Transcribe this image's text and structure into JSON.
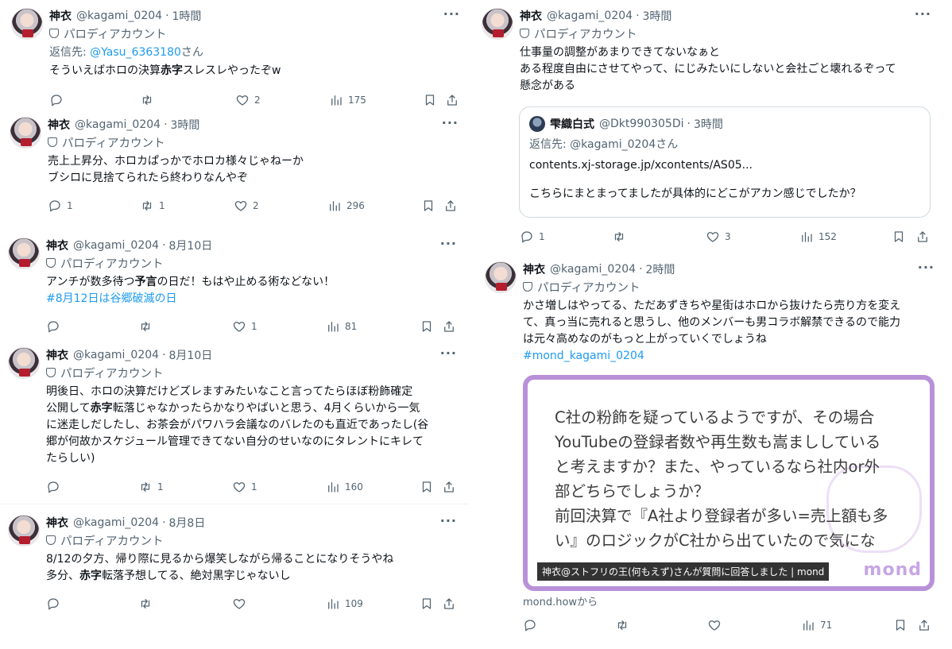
{
  "tweets": [
    {
      "name": "神衣",
      "handle": "@kagami_0204",
      "time": "1時間",
      "parody_label": "パロディアカウント",
      "reply_prefix": "返信先:",
      "reply_handle": "@Yasu_6363180",
      "reply_suffix": "さん",
      "text_a": "そういえばホロの決算",
      "text_bold": "赤字",
      "text_b": "スレスレやったぞw",
      "replies": "",
      "retweets": "",
      "likes": "2",
      "views": "175"
    },
    {
      "name": "神衣",
      "handle": "@kagami_0204",
      "time": "3時間",
      "parody_label": "パロディアカウント",
      "line1": "売上上昇分、ホロカぱっかでホロカ様々じゃねーか",
      "line2": "ブシロに見捨てられたら終わりなんやぞ",
      "replies": "1",
      "retweets": "1",
      "likes": "2",
      "views": "296"
    },
    {
      "name": "神衣",
      "handle": "@kagami_0204",
      "time": "8月10日",
      "parody_label": "パロディアカウント",
      "text_a": "アンチが数多待つ",
      "text_bold": "予言",
      "text_b": "の日だ！もはや止める術などない！",
      "hashtag": "#8月12日は谷郷破滅の日",
      "replies": "",
      "retweets": "",
      "likes": "1",
      "views": "81"
    },
    {
      "name": "神衣",
      "handle": "@kagami_0204",
      "time": "8月10日",
      "parody_label": "パロディアカウント",
      "line1": "明後日、ホロの決算だけどズレますみたいなこと言ってたらほぼ粉飾確定",
      "line2_a": "公開して",
      "line2_bold": "赤字",
      "line2_b": "転落じゃなかったらかなりやばいと思う、4月くらいから一気",
      "line3": "に迷走しだしたし、お茶会がパワハラ会議なのバレたのも直近であったし(谷",
      "line4": "郷が何故かスケジュール管理できてない自分のせいなのにタレントにキレて",
      "line5": "たらしい)",
      "replies": "",
      "retweets": "1",
      "likes": "1",
      "views": "160"
    },
    {
      "name": "神衣",
      "handle": "@kagami_0204",
      "time": "8月8日",
      "parody_label": "パロディアカウント",
      "line1": "8/12の夕方、帰り際に見るから爆笑しながら帰ることになりそうやね",
      "line2_a": "多分、",
      "line2_bold": "赤字",
      "line2_b": "転落予想してる、絶対黒字じゃないし",
      "replies": "",
      "retweets": "",
      "likes": "",
      "views": "109"
    },
    {
      "name": "神衣",
      "handle": "@kagami_0204",
      "time": "3時間",
      "parody_label": "パロディアカウント",
      "line1": "仕事量の調整があまりできてないなぁと",
      "line2": "ある程度自由にさせてやって、にじみたいにしないと会社ごと壊れるぞって",
      "line3": "懸念がある",
      "quote": {
        "name": "雫織白式",
        "handle": "@Dkt990305Di",
        "time": "3時間",
        "reply_line": "返信先: @kagami_0204さん",
        "url": "contents.xj-storage.jp/xcontents/AS05...",
        "question": "こちらにまとまってましたが具体的にどこがアカン感じでしたか？"
      },
      "replies": "1",
      "retweets": "",
      "likes": "3",
      "views": "152"
    },
    {
      "name": "神衣",
      "handle": "@kagami_0204",
      "time": "2時間",
      "parody_label": "パロディアカウント",
      "line1": "かさ増しはやってる、ただあずきちや星街はホロから抜けたら売り方を変え",
      "line2": "て、真っ当に売れると思うし、他のメンバーも男コラボ解禁できるので能力",
      "line3": "は元々高めなのがもっと上がっていくでしょうね",
      "hashtag": "#mond_kagami_0204",
      "card": {
        "line1": "C社の粉飾を疑っているようですが、その場合",
        "line2": "YouTubeの登録者数や再生数も嵩まししている",
        "line3": "と考えますか？また、やっているなら社内or外",
        "line4": "部どちらでしょうか？",
        "line5": "前回決算で『A社より登録者が多い=売上額も多",
        "line6": "い』のロジックがC社から出ていたので気にな",
        "caption": "神衣@ストフリの王(何もえず)さんが質問に回答しました | mond",
        "logo": "mond"
      },
      "source": "mond.howから",
      "replies": "",
      "retweets": "",
      "likes": "",
      "views": "71"
    }
  ],
  "icons": [
    "reply-icon",
    "retweet-icon",
    "like-icon",
    "views-icon",
    "bookmark-icon",
    "share-icon",
    "more-icon",
    "parody-mask-icon"
  ]
}
